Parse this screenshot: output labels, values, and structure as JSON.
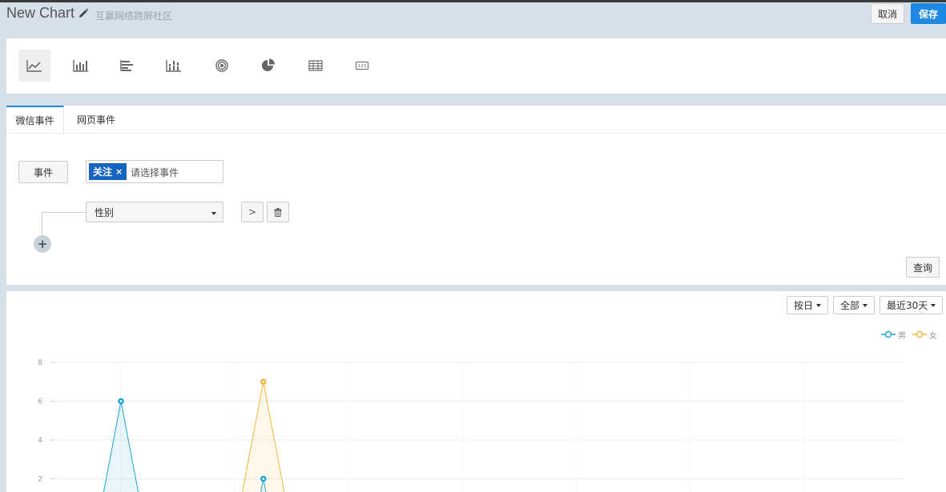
{
  "header": {
    "title": "New Chart",
    "subtitle": "互赢网络跨屏社区",
    "cancel_label": "取消",
    "save_label": "保存",
    "accent_color": "#1e88e5"
  },
  "chart_types": [
    {
      "name": "line",
      "icon": "line-chart-icon",
      "active": true
    },
    {
      "name": "bar",
      "icon": "bar-chart-icon",
      "active": false
    },
    {
      "name": "hbar",
      "icon": "horizontal-bar-chart-icon",
      "active": false
    },
    {
      "name": "stacked",
      "icon": "stacked-bar-chart-icon",
      "active": false
    },
    {
      "name": "target",
      "icon": "target-icon",
      "active": false
    },
    {
      "name": "pie",
      "icon": "pie-chart-icon",
      "active": false
    },
    {
      "name": "table",
      "icon": "table-icon",
      "active": false
    },
    {
      "name": "number",
      "icon": "number-icon",
      "active": false
    }
  ],
  "query": {
    "tabs": [
      "微信事件",
      "网页事件"
    ],
    "active_tab": 0,
    "event_button": "事件",
    "event_tag": "关注",
    "event_tag_remove": "×",
    "event_placeholder": "请选择事件",
    "group_by_value": "性别",
    "next_label": ">",
    "query_button": "查询"
  },
  "chart_controls": {
    "interval": "按日",
    "scope": "全部",
    "range": "最近30天"
  },
  "chart_data": {
    "type": "area",
    "legend_position": "top-right",
    "grid": true,
    "series": [
      {
        "name": "男",
        "color": "#1aa3d9",
        "points": [
          {
            "x": 1,
            "y": 6
          },
          {
            "x": 2.25,
            "y": 2
          }
        ]
      },
      {
        "name": "女",
        "color": "#f5b73b",
        "points": [
          {
            "x": 2.25,
            "y": 7
          }
        ]
      }
    ],
    "y_ticks": [
      "8",
      "6",
      "4",
      "2"
    ],
    "ylim": [
      0,
      8
    ]
  }
}
